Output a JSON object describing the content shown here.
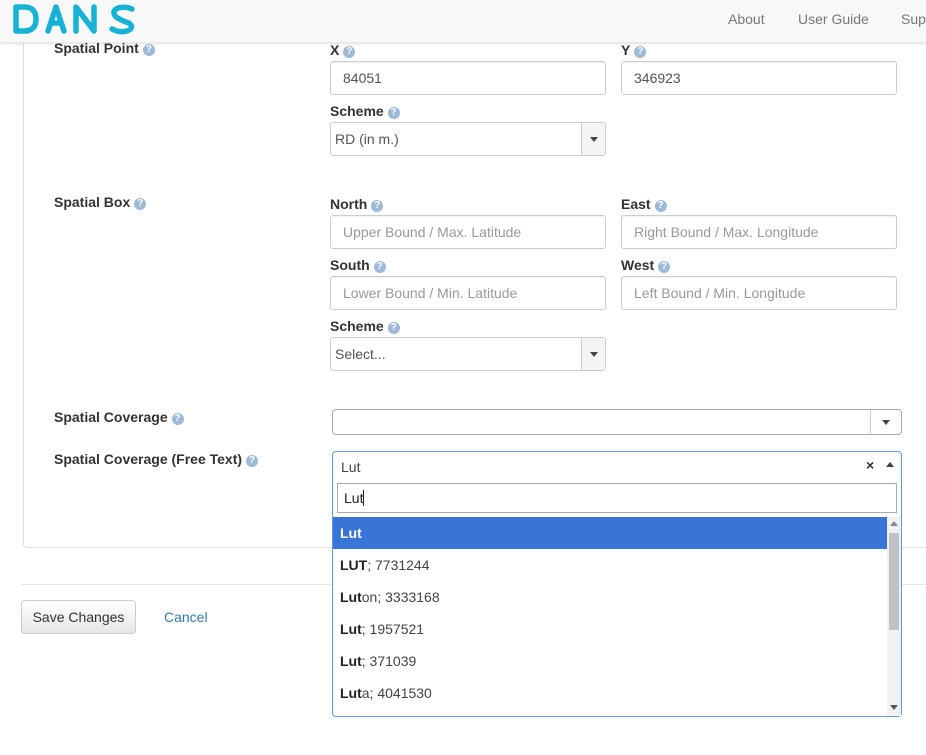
{
  "header": {
    "logo_text": "DANS",
    "nav": [
      "About",
      "User Guide",
      "Sup"
    ]
  },
  "form": {
    "spatial_point": {
      "label": "Spatial Point",
      "x_label": "X",
      "x_value": "84051",
      "y_label": "Y",
      "y_value": "346923",
      "scheme_label": "Scheme",
      "scheme_value": "RD (in m.)"
    },
    "spatial_box": {
      "label": "Spatial Box",
      "north_label": "North",
      "north_placeholder": "Upper Bound / Max. Latitude",
      "east_label": "East",
      "east_placeholder": "Right Bound / Max. Longitude",
      "south_label": "South",
      "south_placeholder": "Lower Bound / Min. Latitude",
      "west_label": "West",
      "west_placeholder": "Left Bound / Min. Longitude",
      "scheme_label": "Scheme",
      "scheme_value": "Select..."
    },
    "spatial_coverage": {
      "label": "Spatial Coverage",
      "value": ""
    },
    "spatial_coverage_free": {
      "label": "Spatial Coverage (Free Text)",
      "selected_value": "Lut",
      "clear_symbol": "×",
      "search_text": "Lut",
      "options": [
        {
          "match": "Lut",
          "rest": ""
        },
        {
          "match": "LUT",
          "rest": "; 7731244"
        },
        {
          "match": "Lut",
          "rest": "on; 3333168"
        },
        {
          "match": "Lut",
          "rest": "; 1957521"
        },
        {
          "match": "Lut",
          "rest": "; 371039"
        },
        {
          "match": "Lut",
          "rest": "a; 4041530"
        }
      ]
    },
    "help_symbol": "?"
  },
  "footer": {
    "save_label": "Save Changes",
    "cancel_label": "Cancel"
  },
  "colors": {
    "brand": "#17b3d6",
    "highlight": "#3875d7",
    "link": "#337ab7",
    "help_icon": "#9eb9d6"
  }
}
